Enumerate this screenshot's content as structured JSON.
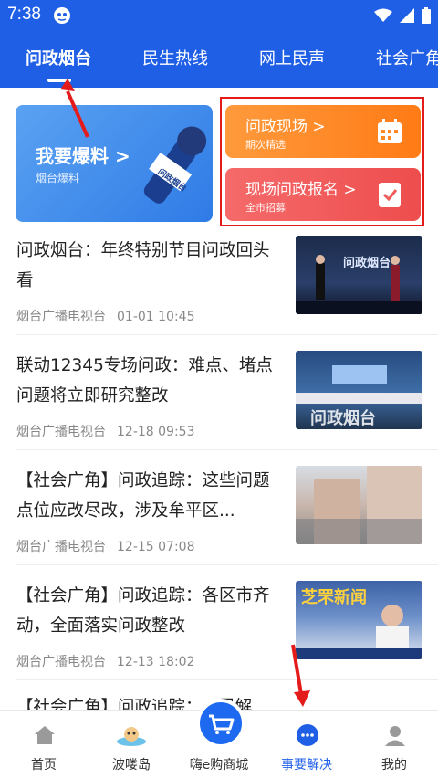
{
  "status_bar": {
    "time": "7:38"
  },
  "tabs": [
    {
      "label": "问政烟台",
      "active": true
    },
    {
      "label": "民生热线",
      "active": false
    },
    {
      "label": "网上民声",
      "active": false
    },
    {
      "label": "社会广角",
      "active": false
    }
  ],
  "feature": {
    "big": {
      "title": "我要爆料 >",
      "subtitle": "烟台爆料",
      "mic_label": "问政烟台"
    },
    "cards": [
      {
        "title": "问政现场 >",
        "subtitle": "期次精选",
        "icon": "calendar-icon",
        "color": "#ff8a25"
      },
      {
        "title": "现场问政报名 >",
        "subtitle": "全市招募",
        "icon": "checklist-icon",
        "color": "#f05a5a"
      }
    ]
  },
  "news": [
    {
      "headline": "问政烟台：年终特别节目问政回头看",
      "source": "烟台广播电视台",
      "date": "01-01 10:45",
      "thumb_text": "问政烟台"
    },
    {
      "headline": "联动12345专场问政：难点、堵点问题将立即研究整改",
      "source": "烟台广播电视台",
      "date": "12-18 09:53",
      "thumb_text": "问政烟台"
    },
    {
      "headline": "【社会广角】问政追踪：这些问题点位应改尽改，涉及牟平区...",
      "source": "烟台广播电视台",
      "date": "12-15 07:08",
      "thumb_text": ""
    },
    {
      "headline": "【社会广角】问政追踪：各区市齐动，全面落实问政整改",
      "source": "烟台广播电视台",
      "date": "12-13 18:02",
      "thumb_text": "芝罘新闻"
    }
  ],
  "peek_headline": "【社会广角】问政追踪：...尽解",
  "bottom_nav": [
    {
      "label": "首页",
      "icon": "home-icon",
      "active": false
    },
    {
      "label": "波喽岛",
      "icon": "island-icon",
      "active": false
    },
    {
      "label": "嗨e购商城",
      "icon": "shopping-cart-icon",
      "active": false
    },
    {
      "label": "事要解决",
      "icon": "chat-bubble-icon",
      "active": true
    },
    {
      "label": "我的",
      "icon": "user-icon",
      "active": false
    }
  ],
  "colors": {
    "primary": "#1f5fe6",
    "annotation_red": "#e41b1b"
  }
}
